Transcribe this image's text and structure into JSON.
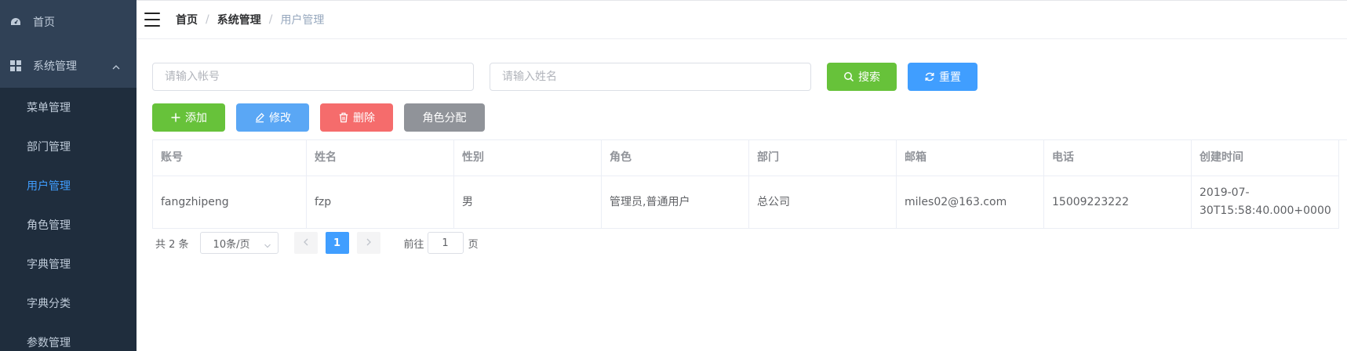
{
  "sidebar": {
    "home_label": "首页",
    "group_label": "系统管理",
    "items": [
      {
        "label": "菜单管理"
      },
      {
        "label": "部门管理"
      },
      {
        "label": "用户管理",
        "active": true
      },
      {
        "label": "角色管理"
      },
      {
        "label": "字典管理"
      },
      {
        "label": "字典分类"
      },
      {
        "label": "参数管理"
      }
    ]
  },
  "breadcrumb": [
    "首页",
    "系统管理",
    "用户管理"
  ],
  "search": {
    "account_placeholder": "请输入帐号",
    "name_placeholder": "请输入姓名",
    "search_label": "搜索",
    "reset_label": "重置"
  },
  "actions": {
    "add_label": "添加",
    "edit_label": "修改",
    "delete_label": "删除",
    "role_label": "角色分配"
  },
  "table": {
    "headers": [
      "账号",
      "姓名",
      "性别",
      "角色",
      "部门",
      "邮箱",
      "电话",
      "创建时间"
    ],
    "rows": [
      [
        "fangzhipeng",
        "fzp",
        "男",
        "管理员,普通用户",
        "总公司",
        "miles02@163.com",
        "15009223222",
        "2019-07-30T15:58:40.000+0000"
      ]
    ]
  },
  "pagination": {
    "total_label": "共 2 条",
    "page_size": "10条/页",
    "current_page": "1",
    "goto_label": "前往",
    "goto_value": "1",
    "unit_label": "页"
  },
  "colors": {
    "sidebar_bg": "#304156",
    "submenu_bg": "#1f2d3d",
    "active": "#409eff",
    "success": "#67c23a",
    "danger": "#f56c6c",
    "info": "#909399"
  }
}
